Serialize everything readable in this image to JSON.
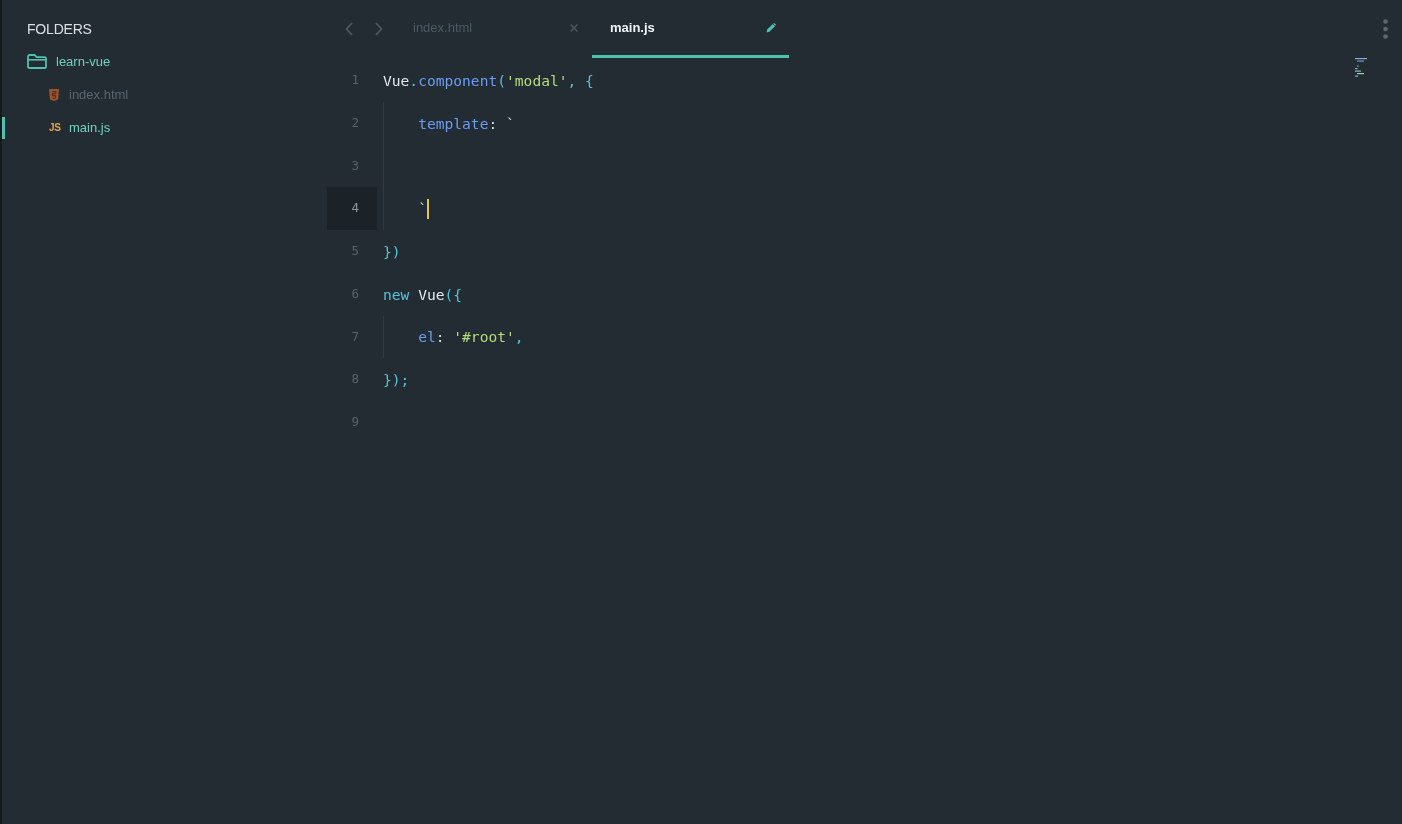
{
  "sidebar": {
    "title": "FOLDERS",
    "tree": [
      {
        "name": "learn-vue",
        "kind": "folder",
        "children": [
          {
            "name": "index.html",
            "kind": "html",
            "selected": false
          },
          {
            "name": "main.js",
            "kind": "js",
            "badge": "JS",
            "selected": true
          }
        ]
      }
    ]
  },
  "tabs": [
    {
      "label": "index.html",
      "selected": false,
      "modified": false
    },
    {
      "label": "main.js",
      "selected": true,
      "modified": true
    }
  ],
  "editor": {
    "lines": [
      {
        "number": "1",
        "indented": false,
        "current": false,
        "tokens": [
          {
            "text": "Vue",
            "kind": "identifier"
          },
          {
            "text": ".",
            "kind": "punctuation"
          },
          {
            "text": "component",
            "kind": "method"
          },
          {
            "text": "(",
            "kind": "punctuation"
          },
          {
            "text": "'modal'",
            "kind": "string"
          },
          {
            "text": ", {",
            "kind": "punctuation"
          }
        ]
      },
      {
        "number": "2",
        "indented": true,
        "current": false,
        "tokens": [
          {
            "text": "template",
            "kind": "property"
          },
          {
            "text": ": `",
            "kind": "plain"
          }
        ]
      },
      {
        "number": "3",
        "indented": true,
        "current": false
      },
      {
        "number": "4",
        "indented": true,
        "current": true,
        "tokens": [
          {
            "text": "`",
            "kind": "plain"
          }
        ]
      },
      {
        "number": "5",
        "indented": false,
        "current": false,
        "tokens": [
          {
            "text": "})",
            "kind": "punctuation"
          }
        ]
      },
      {
        "number": "6",
        "indented": false,
        "current": false,
        "tokens": [
          {
            "text": "new",
            "kind": "keyword"
          },
          {
            "text": " Vue",
            "kind": "identifier"
          },
          {
            "text": "({",
            "kind": "punctuation"
          }
        ]
      },
      {
        "number": "7",
        "indented": true,
        "current": false,
        "tokens": [
          {
            "text": "el",
            "kind": "property"
          },
          {
            "text": ": ",
            "kind": "plain"
          },
          {
            "text": "'#root'",
            "kind": "string"
          },
          {
            "text": ",",
            "kind": "punctuation"
          }
        ]
      },
      {
        "number": "8",
        "indented": false,
        "current": false,
        "tokens": [
          {
            "text": "});",
            "kind": "punctuation"
          }
        ]
      },
      {
        "number": "9",
        "indented": false,
        "current": false
      }
    ]
  }
}
